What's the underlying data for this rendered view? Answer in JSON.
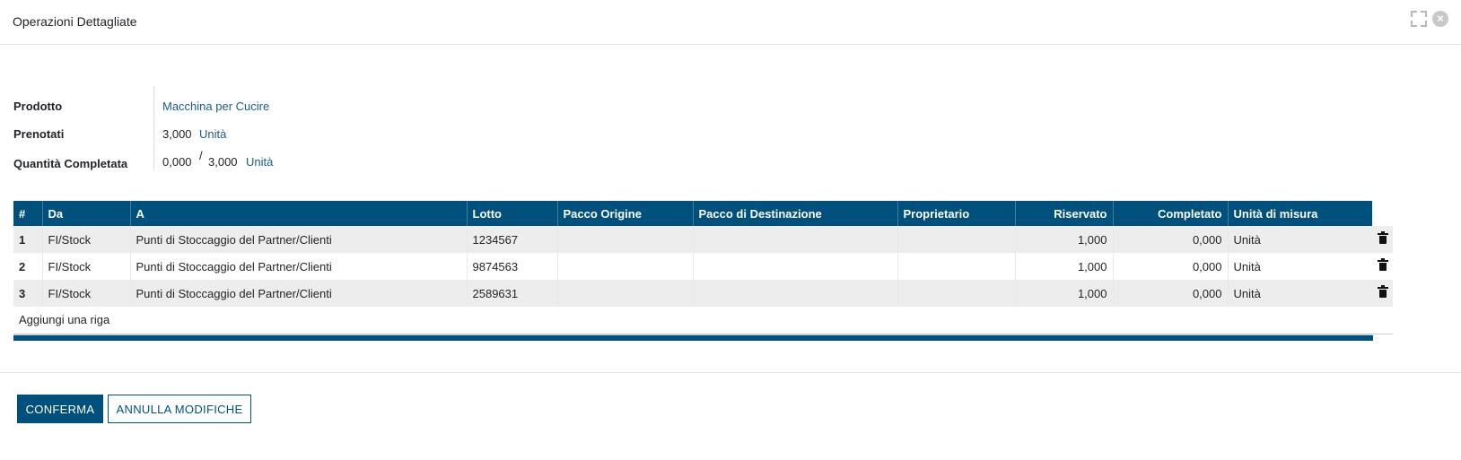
{
  "dialog": {
    "title": "Operazioni Dettagliate"
  },
  "form": {
    "product_label": "Prodotto",
    "product_value": "Macchina per Cucire",
    "reserved_label": "Prenotati",
    "reserved_qty": "3,000",
    "reserved_uom": "Unità",
    "done_label": "Quantità Completata",
    "done_qty": "0,000",
    "done_sep": "/",
    "done_total": "3,000",
    "done_uom": "Unità"
  },
  "table": {
    "headers": [
      "#",
      "Da",
      "A",
      "Lotto",
      "Pacco Origine",
      "Pacco di Destinazione",
      "Proprietario",
      "Riservato",
      "Completato",
      "Unità di misura"
    ],
    "rows": [
      {
        "idx": "1",
        "from": "FI/Stock",
        "to": "Punti di Stoccaggio del Partner/Clienti",
        "lot": "1234567",
        "src_pkg": "",
        "dst_pkg": "",
        "owner": "",
        "reserved": "1,000",
        "done": "0,000",
        "uom": "Unità"
      },
      {
        "idx": "2",
        "from": "FI/Stock",
        "to": "Punti di Stoccaggio del Partner/Clienti",
        "lot": "9874563",
        "src_pkg": "",
        "dst_pkg": "",
        "owner": "",
        "reserved": "1,000",
        "done": "0,000",
        "uom": "Unità"
      },
      {
        "idx": "3",
        "from": "FI/Stock",
        "to": "Punti di Stoccaggio del Partner/Clienti",
        "lot": "2589631",
        "src_pkg": "",
        "dst_pkg": "",
        "owner": "",
        "reserved": "1,000",
        "done": "0,000",
        "uom": "Unità"
      }
    ],
    "add_line": "Aggiungi una riga"
  },
  "footer": {
    "confirm_label": "CONFERMA",
    "discard_label": "ANNULLA MODIFICHE"
  },
  "colors": {
    "primary": "#00507e",
    "link": "#1d5a8a",
    "row_alt": "#ededed"
  },
  "icons": [
    "expand-icon",
    "close-icon",
    "trash-icon"
  ]
}
